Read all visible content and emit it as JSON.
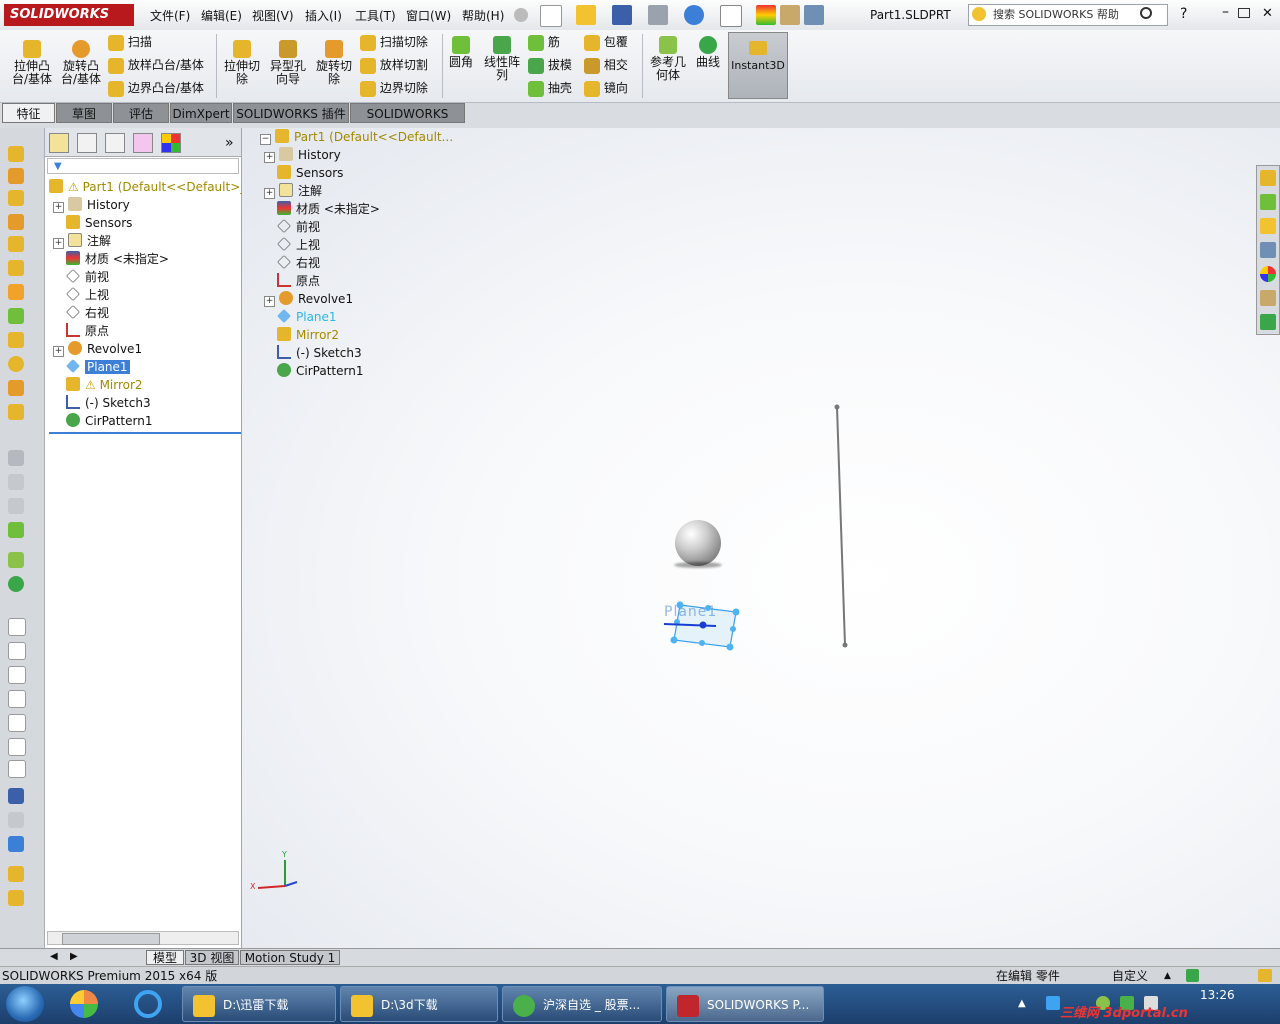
{
  "app": {
    "logo_text": "SOLIDWORKS",
    "document_title": "Part1.SLDPRT"
  },
  "menu": [
    "文件(F)",
    "编辑(E)",
    "视图(V)",
    "插入(I)",
    "工具(T)",
    "窗口(W)",
    "帮助(H)"
  ],
  "search": {
    "placeholder": "搜索 SOLIDWORKS 帮助"
  },
  "commands": {
    "extrude_boss": "拉伸凸台/基体",
    "revolve_boss": "旋转凸台/基体",
    "sweep": "扫描",
    "loft": "放样凸台/基体",
    "boundary": "边界凸台/基体",
    "extrude_cut": "拉伸切除",
    "hole_wizard": "异型孔向导",
    "revolve_cut": "旋转切除",
    "swept_cut": "扫描切除",
    "lofted_cut": "放样切割",
    "boundary_cut": "边界切除",
    "fillet": "圆角",
    "linear_pattern": "线性阵列",
    "rib": "筋",
    "draft": "拔模",
    "shell": "抽壳",
    "wrap": "包覆",
    "intersect": "相交",
    "mirror": "镜向",
    "ref_geometry": "参考几何体",
    "curves": "曲线",
    "instant3d": "Instant3D"
  },
  "tabs": [
    "特征",
    "草图",
    "评估",
    "DimXpert",
    "SOLIDWORKS 插件",
    "SOLIDWORKS MBD"
  ],
  "tree": {
    "root": "Part1  (Default<<Default>_",
    "items": [
      "History",
      "Sensors",
      "注解",
      "材质 <未指定>",
      "前视",
      "上视",
      "右视",
      "原点",
      "Revolve1",
      "Plane1",
      "Mirror2",
      "(-) Sketch3",
      "CirPattern1"
    ]
  },
  "gfx_tree": {
    "root": "Part1  (Default<<Default...",
    "items": [
      "History",
      "Sensors",
      "注解",
      "材质 <未指定>",
      "前视",
      "上视",
      "右视",
      "原点",
      "Revolve1",
      "Plane1",
      "Mirror2",
      "(-) Sketch3",
      "CirPattern1"
    ]
  },
  "plane_label": "Plane1",
  "triad": {
    "x_label": "X",
    "y_label": "Y"
  },
  "bottom_tabs": [
    "模型",
    "3D 视图",
    "Motion Study 1"
  ],
  "status": {
    "product": "SOLIDWORKS Premium 2015 x64 版",
    "mode": "在编辑 零件",
    "custom": "自定义"
  },
  "taskbar": {
    "buttons": [
      "D:\\迅雷下载",
      "D:\\3d下载",
      "沪深自选 _ 股票...",
      "SOLIDWORKS P..."
    ],
    "time": "13:26",
    "watermark": "三维网 3dportal.cn"
  },
  "colors": {
    "accent": "#b7191c",
    "selection": "#3b7fd8",
    "plane": "#2ab7e8",
    "warning": "#a08a00"
  }
}
